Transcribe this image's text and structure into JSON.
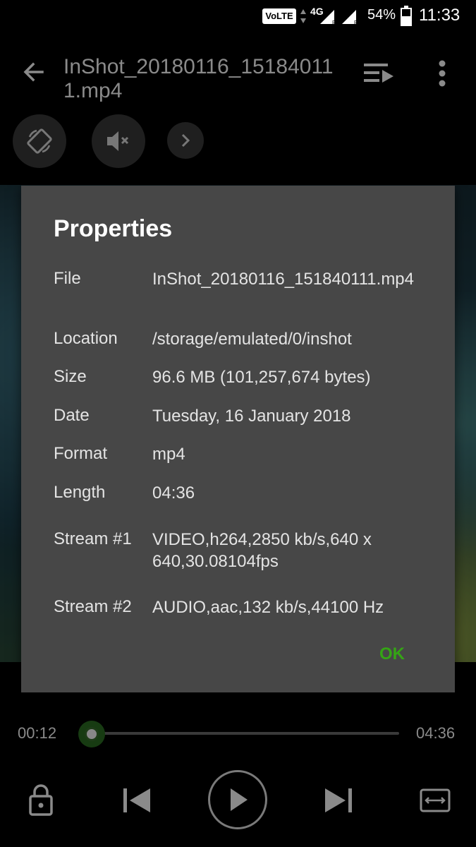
{
  "status_bar": {
    "volte": "VoLTE",
    "network": "4G",
    "battery": "54%",
    "time": "11:33"
  },
  "top_bar": {
    "title": "InShot_20180116_151840111.mp4"
  },
  "dialog": {
    "title": "Properties",
    "rows": [
      {
        "label": "File",
        "value": "InShot_20180116_151840111.mp4"
      },
      {
        "label": "Location",
        "value": "/storage/emulated/0/inshot"
      },
      {
        "label": "Size",
        "value": "96.6 MB (101,257,674 bytes)"
      },
      {
        "label": "Date",
        "value": "Tuesday, 16 January 2018"
      },
      {
        "label": "Format",
        "value": "mp4"
      },
      {
        "label": "Length",
        "value": "04:36"
      },
      {
        "label": "Stream #1",
        "value": "VIDEO,h264,2850 kb/s,640 x 640,30.08104fps"
      },
      {
        "label": "Stream #2",
        "value": "AUDIO,aac,132 kb/s,44100 Hz"
      }
    ],
    "ok_label": "OK"
  },
  "player": {
    "current_time": "00:12",
    "total_time": "04:36",
    "progress_fraction": 0.043
  },
  "colors": {
    "accent_green": "#35a415",
    "dialog_bg": "#474747"
  },
  "icons": {
    "back": "arrow-left-icon",
    "playlist": "playlist-play-icon",
    "more": "more-vert-icon",
    "rotate": "screen-rotation-icon",
    "mute": "volume-off-icon",
    "expand": "chevron-right-icon",
    "lock": "lock-icon",
    "previous": "skip-previous-icon",
    "play": "play-icon",
    "next": "skip-next-icon",
    "aspect": "aspect-ratio-icon"
  }
}
